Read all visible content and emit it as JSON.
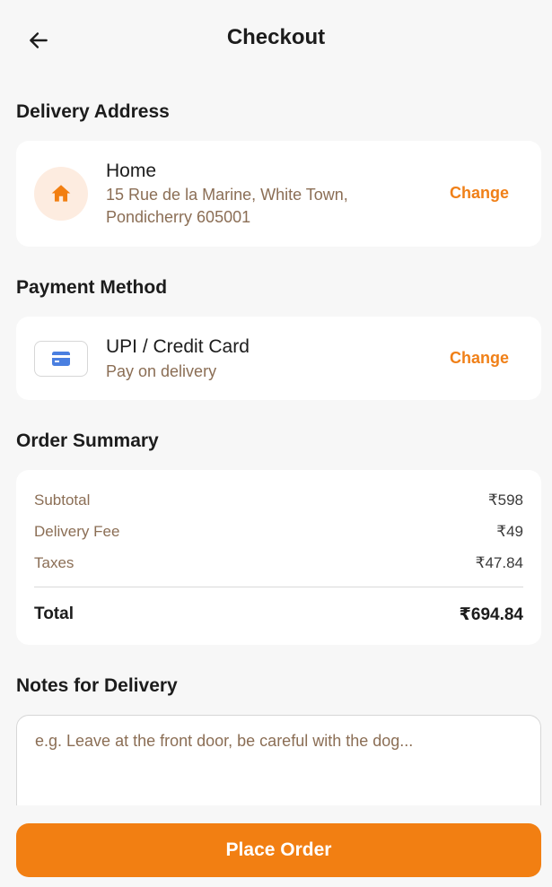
{
  "header": {
    "title": "Checkout",
    "back_icon": "arrow-left-icon"
  },
  "address": {
    "section_title": "Delivery Address",
    "icon": "home-icon",
    "label": "Home",
    "line1": "15 Rue de la Marine, White Town,",
    "line2": "Pondicherry 605001",
    "change_label": "Change"
  },
  "payment": {
    "section_title": "Payment Method",
    "icon": "credit-card-icon",
    "method": "UPI / Credit Card",
    "detail": "Pay on delivery",
    "change_label": "Change"
  },
  "summary": {
    "section_title": "Order Summary",
    "rows": [
      {
        "label": "Subtotal",
        "value": "₹598"
      },
      {
        "label": "Delivery Fee",
        "value": "₹49"
      },
      {
        "label": "Taxes",
        "value": "₹47.84"
      }
    ],
    "total_label": "Total",
    "total_value": "₹694.84"
  },
  "notes": {
    "section_title": "Notes for Delivery",
    "placeholder": "e.g. Leave at the front door, be careful with the dog..."
  },
  "actions": {
    "place_order_label": "Place Order"
  },
  "colors": {
    "accent": "#f27f12",
    "muted_text": "#8b6e55",
    "icon_bg": "#fdece0",
    "card_icon": "#4a7fe0"
  }
}
